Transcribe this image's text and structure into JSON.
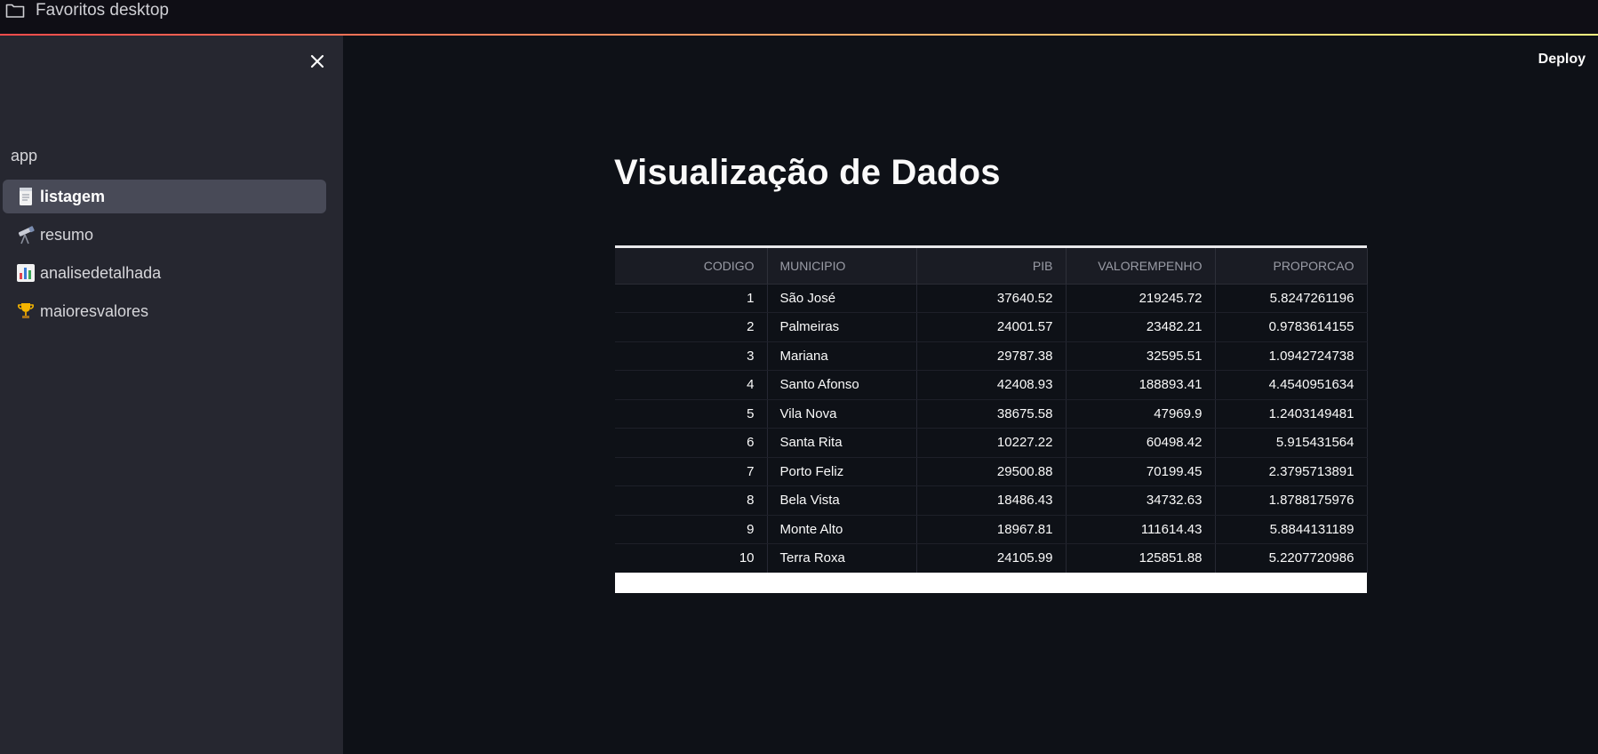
{
  "bookmark_bar": {
    "folder_icon": "folder-icon",
    "label": "Favoritos desktop"
  },
  "colors": {
    "background": "#0e1117",
    "sidebar": "#262730",
    "accent_gradient_start": "#ff4b4b",
    "accent_gradient_end": "#fffd80",
    "active_nav": "#484a57"
  },
  "sidebar": {
    "close_icon": "close-icon",
    "section_label": "app",
    "items": [
      {
        "label": "listagem",
        "icon": "page-icon",
        "active": true
      },
      {
        "label": "resumo",
        "icon": "telescope-icon",
        "active": false
      },
      {
        "label": "analisedetalhada",
        "icon": "bar-chart-icon",
        "active": false
      },
      {
        "label": "maioresvalores",
        "icon": "trophy-icon",
        "active": false
      }
    ]
  },
  "header": {
    "deploy_label": "Deploy"
  },
  "main": {
    "title": "Visualização de Dados",
    "table": {
      "columns": [
        "CODIGO",
        "MUNICIPIO",
        "PIB",
        "VALOREMPENHO",
        "PROPORCAO"
      ],
      "rows": [
        [
          "1",
          "São José",
          "37640.52",
          "219245.72",
          "5.8247261196"
        ],
        [
          "2",
          "Palmeiras",
          "24001.57",
          "23482.21",
          "0.9783614155"
        ],
        [
          "3",
          "Mariana",
          "29787.38",
          "32595.51",
          "1.0942724738"
        ],
        [
          "4",
          "Santo Afonso",
          "42408.93",
          "188893.41",
          "4.4540951634"
        ],
        [
          "5",
          "Vila Nova",
          "38675.58",
          "47969.9",
          "1.2403149481"
        ],
        [
          "6",
          "Santa Rita",
          "10227.22",
          "60498.42",
          "5.915431564"
        ],
        [
          "7",
          "Porto Feliz",
          "29500.88",
          "70199.45",
          "2.3795713891"
        ],
        [
          "8",
          "Bela Vista",
          "18486.43",
          "34732.63",
          "1.8788175976"
        ],
        [
          "9",
          "Monte Alto",
          "18967.81",
          "111614.43",
          "5.8844131189"
        ],
        [
          "10",
          "Terra Roxa",
          "24105.99",
          "125851.88",
          "5.2207720986"
        ]
      ]
    }
  }
}
